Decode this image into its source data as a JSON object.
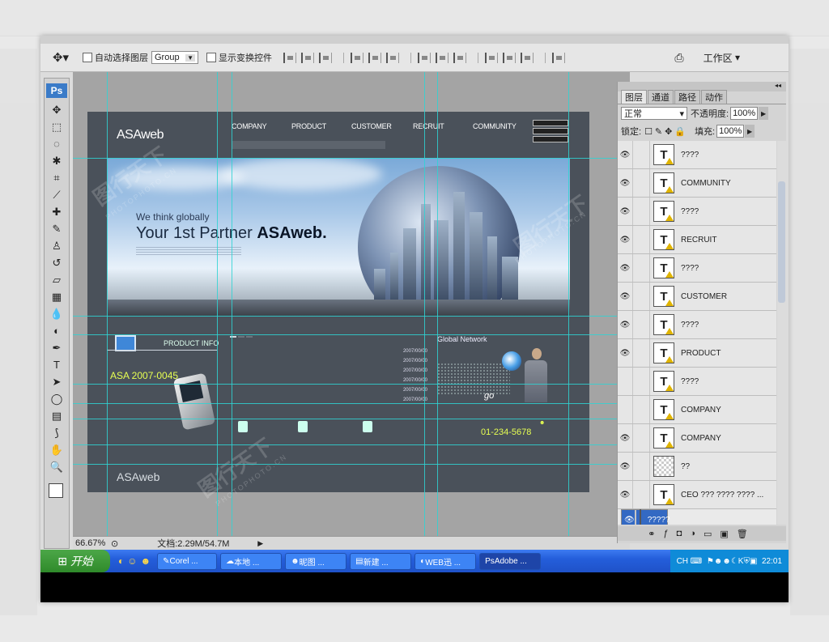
{
  "options_bar": {
    "auto_select_label": "自动选择图层",
    "auto_select_value": "Group",
    "show_transform_label": "显示变换控件",
    "workspace_label": "工作区"
  },
  "toolbox": {
    "ps_label": "Ps"
  },
  "status": {
    "zoom": "66.67%",
    "doc_info": "文档:2.29M/54.7M"
  },
  "canvas_design": {
    "logo": "ASAweb",
    "nav": [
      "COMPANY",
      "PRODUCT",
      "CUSTOMER",
      "RECRUIT",
      "COMMUNITY"
    ],
    "hero_small": "We think globally",
    "hero_big_prefix": "Your 1st Partner ",
    "hero_big_bold": "ASAweb.",
    "product_info": "PRODUCT INFO",
    "model": "ASA 2007-0045",
    "global_network": "Global Network",
    "go": "go",
    "phone_number": "01-234-5678",
    "news_dates": [
      "2007/00/00",
      "2007/00/00",
      "2007/00/00",
      "2007/00/00",
      "2007/00/00",
      "2007/00/00"
    ],
    "footer_logo": "ASAweb"
  },
  "watermark": {
    "text": "图行天下",
    "sub": "PHOTOPHOTO.CN"
  },
  "layers_panel": {
    "tabs": [
      "图层",
      "通道",
      "路径",
      "动作"
    ],
    "blend_mode": "正常",
    "opacity_label": "不透明度:",
    "opacity_value": "100%",
    "lock_label": "锁定:",
    "fill_label": "填充:",
    "fill_value": "100%",
    "layers": [
      {
        "name": "????",
        "type": "text",
        "visible": true
      },
      {
        "name": "COMMUNITY",
        "type": "text",
        "visible": true
      },
      {
        "name": "????",
        "type": "text",
        "visible": true
      },
      {
        "name": "RECRUIT",
        "type": "text",
        "visible": true
      },
      {
        "name": "????",
        "type": "text",
        "visible": true
      },
      {
        "name": "CUSTOMER",
        "type": "text",
        "visible": true
      },
      {
        "name": "????",
        "type": "text",
        "visible": true
      },
      {
        "name": "PRODUCT",
        "type": "text",
        "visible": true
      },
      {
        "name": "????",
        "type": "text",
        "visible": false
      },
      {
        "name": "COMPANY",
        "type": "text",
        "visible": false
      },
      {
        "name": "COMPANY",
        "type": "text",
        "visible": true
      },
      {
        "name": "??",
        "type": "raster",
        "visible": true
      },
      {
        "name": "CEO ???    ????    ???? ...",
        "type": "text",
        "visible": true
      },
      {
        "name": "?????",
        "type": "raster",
        "visible": true,
        "selected": true
      }
    ]
  },
  "taskbar": {
    "start": "开始",
    "tasks": [
      "Corel ...",
      "本地 ...",
      "昵图 ...",
      "新建 ...",
      "WEB迅 ...",
      "Adobe ..."
    ],
    "active_task": 5,
    "ime": "CH",
    "clock": "22:01"
  }
}
